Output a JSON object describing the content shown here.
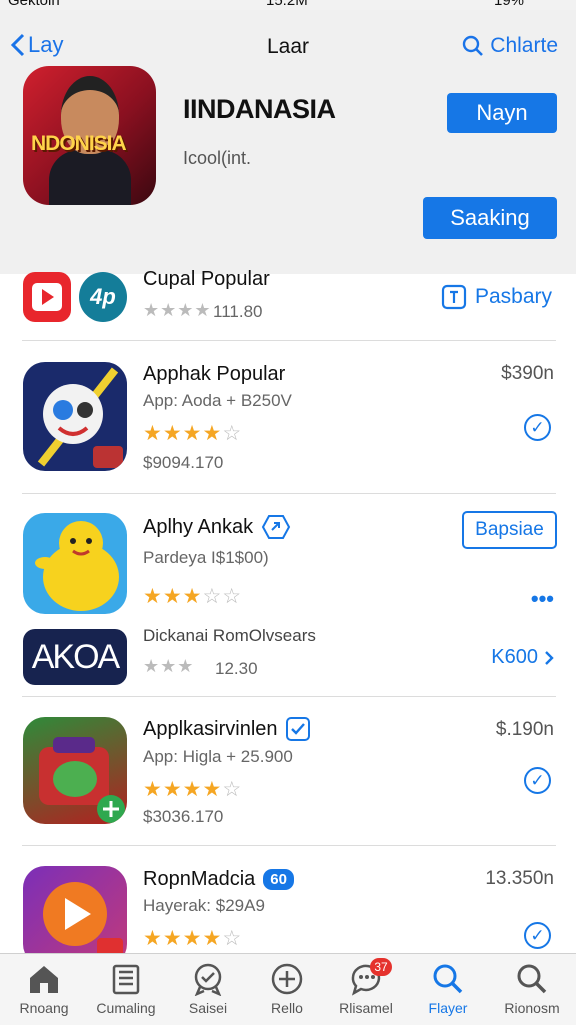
{
  "status_bar": {
    "carrier": "Gektoin",
    "time": "15:2M",
    "battery": "19%"
  },
  "nav": {
    "back_label": "Lay",
    "title": "Laar",
    "search_label": "Chlarte"
  },
  "featured": {
    "icon_text": "NDONISIA",
    "name": "IINDANASIA",
    "subtitle": "Icool(int.",
    "primary_button": "Nayn",
    "secondary_button": "Saaking"
  },
  "apps": [
    {
      "name": "Cupal Popular",
      "rating_text": "111.80",
      "stars": 0,
      "action_label": "Pasbary"
    },
    {
      "name": "Apphak Popular",
      "subtitle": "App: Aoda + B250V",
      "stars": 4,
      "price_detail": "$9094.170",
      "price": "$390n"
    },
    {
      "name": "Aplhy Ankak",
      "subtitle": "Pardeya I$1$00)",
      "stars": 3,
      "action_label": "Bapsiae",
      "more": "•••"
    },
    {
      "name": "Dickanai RomOlvsears",
      "icon_text": "AKOA",
      "rating_text": "12.30",
      "link_label": "K600"
    },
    {
      "name": "Applkasirvinlen",
      "subtitle": "App: Higla + 25.900",
      "stars": 4,
      "price_detail": "$3036.170",
      "price": "$.190n"
    },
    {
      "name": "RopnMadcia",
      "badge": "60",
      "subtitle": "Hayerak: $29A9",
      "stars": 4,
      "price": "13.350n"
    }
  ],
  "tabs": [
    {
      "label": "Rnoang",
      "icon": "home-icon"
    },
    {
      "label": "Cumaling",
      "icon": "library-icon"
    },
    {
      "label": "Saisei",
      "icon": "badge-icon"
    },
    {
      "label": "Rello",
      "icon": "add-icon"
    },
    {
      "label": "Rlisamel",
      "icon": "chat-icon",
      "badge": "37"
    },
    {
      "label": "Flayer",
      "icon": "search-icon",
      "active": true
    },
    {
      "label": "Rionosm",
      "icon": "search-icon"
    }
  ],
  "colors": {
    "accent": "#1677e6",
    "star": "#f5a623",
    "badge": "#e5322d"
  }
}
